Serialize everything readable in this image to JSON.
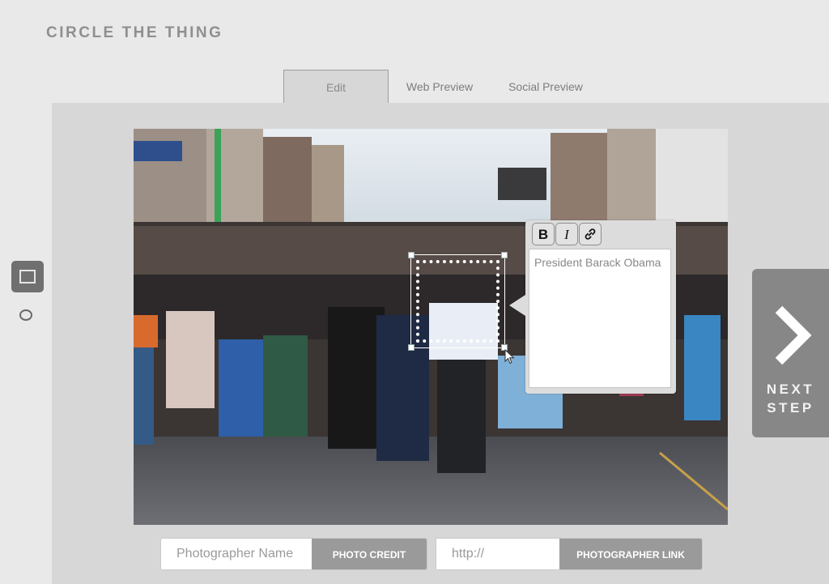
{
  "app": {
    "title": "CIRCLE THE THING"
  },
  "tabs": [
    {
      "label": "Edit",
      "active": true
    },
    {
      "label": "Web Preview",
      "active": false
    },
    {
      "label": "Social Preview",
      "active": false
    }
  ],
  "tools": {
    "rectangle_icon": "rectangle-icon",
    "circle_icon": "circle-icon",
    "selected": "rectangle"
  },
  "editor": {
    "buttons": [
      {
        "label": "B",
        "icon": "bold-icon"
      },
      {
        "label": "I",
        "icon": "italic-icon"
      },
      {
        "label": "",
        "icon": "link-icon"
      }
    ],
    "caption_text": "President Barack Obama"
  },
  "next_step": {
    "label_line1": "NEXT",
    "label_line2": "STEP"
  },
  "credit": {
    "name_placeholder": "Photographer Name",
    "credit_button": "PHOTO CREDIT",
    "link_placeholder": "http://",
    "link_button": "PHOTOGRAPHER LINK"
  },
  "colors": {
    "background": "#e9e9e9",
    "workspace": "#d7d7d7",
    "button_gray": "#9a9a9a",
    "next_step": "#878787"
  }
}
